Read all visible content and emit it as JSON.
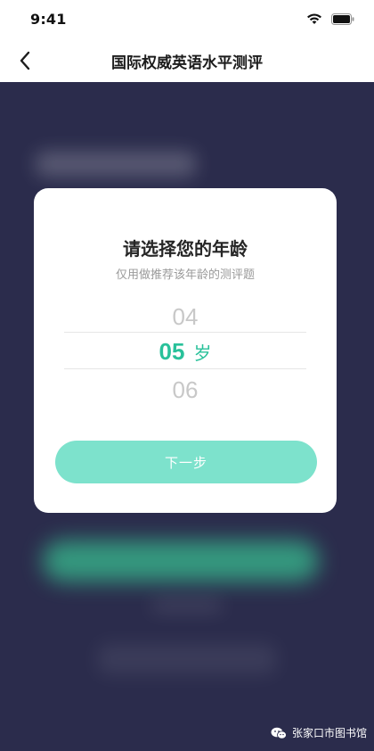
{
  "status_bar": {
    "time": "9:41",
    "icons": [
      "wifi-icon",
      "battery-icon"
    ]
  },
  "nav": {
    "back_icon": "chevron-left-icon",
    "title": "国际权威英语水平测评"
  },
  "dialog": {
    "title": "请选择您的年龄",
    "subtitle": "仅用做推荐该年龄的测评题",
    "picker": {
      "previous": "04",
      "selected": "05",
      "unit": "岁",
      "next": "06"
    },
    "next_button_label": "下一步"
  },
  "watermark": {
    "icon": "wechat-icon",
    "text": "张家口市图书馆"
  },
  "colors": {
    "background": "#2b2c4c",
    "accent": "#29c19a",
    "button": "#7de2cc"
  }
}
